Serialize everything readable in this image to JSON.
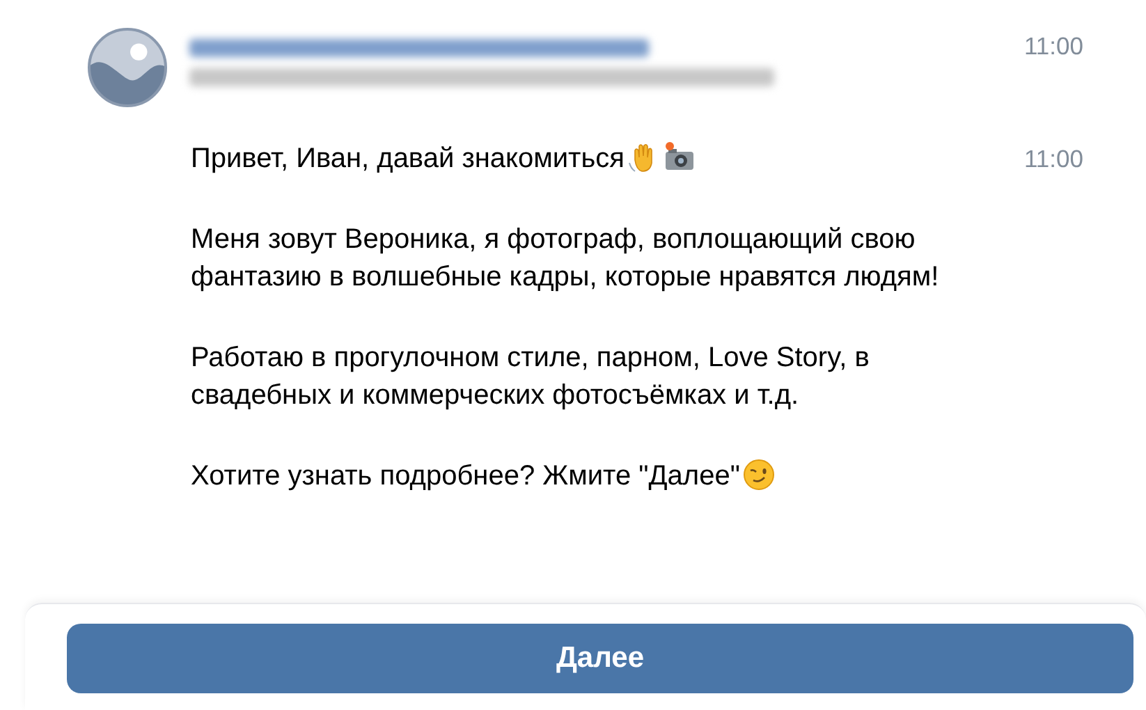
{
  "header": {
    "time": "11:00"
  },
  "message": {
    "time": "11:00",
    "paragraphs": [
      {
        "text": "Привет, Иван, давай знакомиться",
        "emoji": [
          {
            "kind": "wave"
          },
          {
            "kind": "camera"
          }
        ]
      },
      {
        "text": "Меня зовут Вероника, я фотограф, воплощающий свою фантазию в волшебные кадры, которые нравятся людям!"
      },
      {
        "text": "Работаю в прогулочном стиле, парном, Love Story, в свадебных и коммерческих фотосъёмках и т.д."
      },
      {
        "text": "Хотите узнать подробнее? Жмите \"Далее\"",
        "emoji": [
          {
            "kind": "wink"
          }
        ]
      }
    ]
  },
  "button": {
    "label": "Далее"
  }
}
